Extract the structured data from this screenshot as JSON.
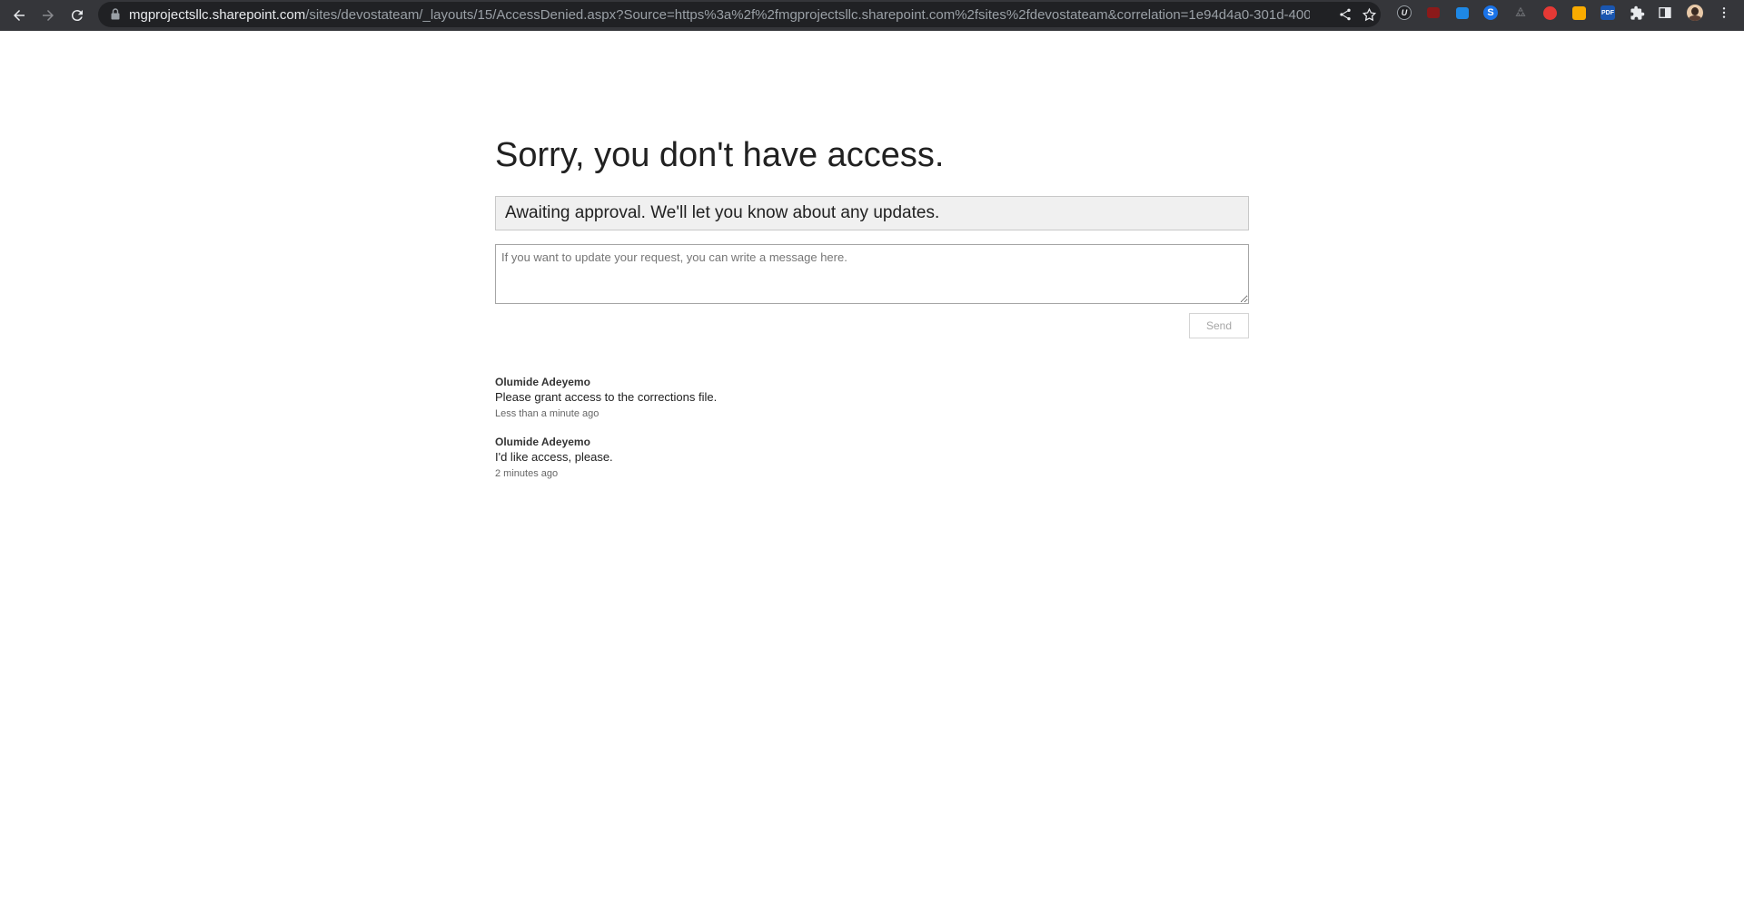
{
  "browser": {
    "url_host": "mgprojectsllc.sharepoint.com",
    "url_path": "/sites/devostateam/_layouts/15/AccessDenied.aspx?Source=https%3a%2f%2fmgprojectsllc.sharepoint.com%2fsites%2fdevostateam&correlation=1e94d4a0-301d-4000-304b-3...",
    "extension_labels": {
      "pdf": "PDF"
    }
  },
  "page": {
    "title": "Sorry, you don't have access.",
    "status": "Awaiting approval. We'll let you know about any updates.",
    "message_placeholder": "If you want to update your request, you can write a message here.",
    "send_label": "Send"
  },
  "history": [
    {
      "author": "Olumide Adeyemo",
      "text": "Please grant access to the corrections file.",
      "time": "Less than a minute ago"
    },
    {
      "author": "Olumide Adeyemo",
      "text": "I'd like access, please.",
      "time": "2 minutes ago"
    }
  ]
}
